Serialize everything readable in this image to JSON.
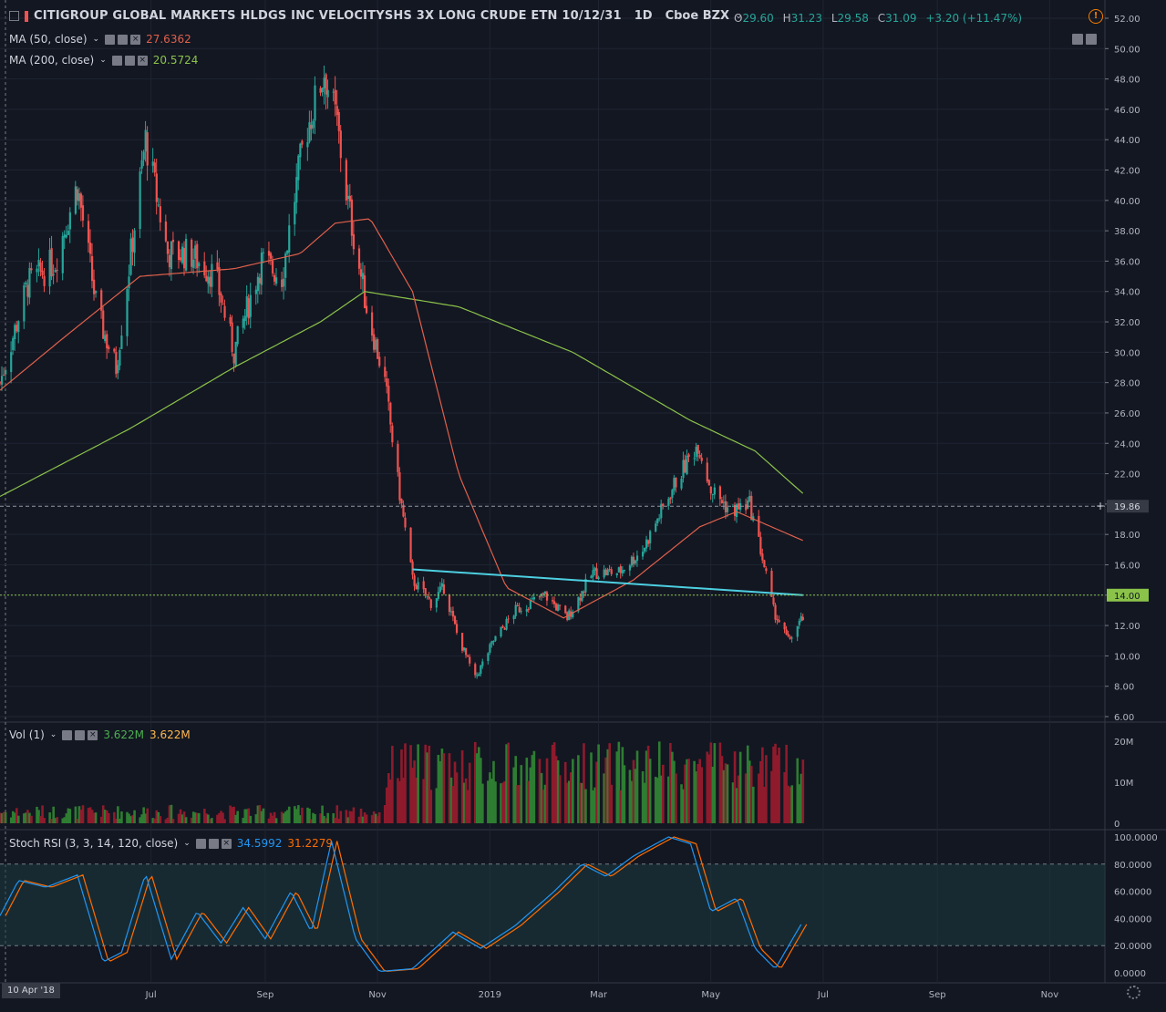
{
  "header": {
    "title": "CITIGROUP GLOBAL MARKETS HLDGS INC VELOCITYSHS 3X LONG CRUDE ETN 10/12/31",
    "interval": "1D",
    "exchange": "Cboe BZX",
    "ohlc": {
      "o": "29.60",
      "h": "31.23",
      "l": "29.58",
      "c": "31.09",
      "change": "+3.20 (+11.47%)"
    }
  },
  "indicators": {
    "ma50": {
      "label": "MA (50, close)",
      "value": "27.6362",
      "color": "#e0604b"
    },
    "ma200": {
      "label": "MA (200, close)",
      "value": "20.5724",
      "color": "#8bc34a"
    },
    "vol": {
      "label": "Vol (1)",
      "value1": "3.622M",
      "value2": "3.622M"
    },
    "stoch": {
      "label": "Stoch RSI (3, 3, 14, 120, close)",
      "k": "34.5992",
      "d": "31.2279",
      "k_color": "#2196f3",
      "d_color": "#ff6d00"
    }
  },
  "date_badge": "10 Apr '18",
  "crosshair_price": "19.86",
  "level_price": "14.00",
  "colors": {
    "up": "#26a69a",
    "down": "#ef5350",
    "bull": "#4caf50",
    "bear": "#e53950",
    "trend": "#4dd0e1",
    "level": "#8bc34a",
    "bg": "#131722",
    "grid": "#1f2432"
  },
  "chart_data": {
    "type": "line",
    "price_axis": {
      "ylim": [
        6,
        52
      ],
      "ticks": [
        "52.00",
        "50.00",
        "48.00",
        "46.00",
        "44.00",
        "42.00",
        "40.00",
        "38.00",
        "36.00",
        "34.00",
        "32.00",
        "30.00",
        "28.00",
        "26.00",
        "24.00",
        "22.00",
        "20.00",
        "18.00",
        "16.00",
        "14.00",
        "12.00",
        "10.00",
        "8.00",
        "6.00"
      ]
    },
    "x_ticks": [
      {
        "label": "Jul",
        "date": "2018-07-01"
      },
      {
        "label": "Sep",
        "date": "2018-09-01"
      },
      {
        "label": "Nov",
        "date": "2018-11-01"
      },
      {
        "label": "2019",
        "date": "2019-01-01"
      },
      {
        "label": "Mar",
        "date": "2019-03-01"
      },
      {
        "label": "May",
        "date": "2019-05-01"
      },
      {
        "label": "Jul",
        "date": "2019-07-01"
      },
      {
        "label": "Sep",
        "date": "2019-09-01"
      },
      {
        "label": "Nov",
        "date": "2019-11-01"
      }
    ],
    "xlim": [
      "2018-04-10",
      "2019-12-01"
    ],
    "price_anchors": [
      [
        "2018-04-10",
        28.0
      ],
      [
        "2018-04-25",
        34.5
      ],
      [
        "2018-05-10",
        36.0
      ],
      [
        "2018-05-22",
        41.0
      ],
      [
        "2018-06-02",
        32.5
      ],
      [
        "2018-06-12",
        29.0
      ],
      [
        "2018-06-28",
        44.0
      ],
      [
        "2018-07-10",
        36.5
      ],
      [
        "2018-07-22",
        36.5
      ],
      [
        "2018-08-05",
        35.0
      ],
      [
        "2018-08-15",
        30.0
      ],
      [
        "2018-08-30",
        36.0
      ],
      [
        "2018-09-10",
        35.0
      ],
      [
        "2018-09-22",
        44.0
      ],
      [
        "2018-10-03",
        48.5
      ],
      [
        "2018-10-10",
        45.0
      ],
      [
        "2018-10-15",
        40.5
      ],
      [
        "2018-10-20",
        37.0
      ],
      [
        "2018-10-26",
        33.0
      ],
      [
        "2018-11-05",
        28.0
      ],
      [
        "2018-11-12",
        21.5
      ],
      [
        "2018-11-20",
        15.0
      ],
      [
        "2018-11-30",
        13.5
      ],
      [
        "2018-12-07",
        14.5
      ],
      [
        "2018-12-14",
        11.5
      ],
      [
        "2018-12-24",
        8.5
      ],
      [
        "2019-01-03",
        11.0
      ],
      [
        "2019-01-15",
        13.0
      ],
      [
        "2019-01-31",
        14.0
      ],
      [
        "2019-02-12",
        12.5
      ],
      [
        "2019-02-26",
        15.5
      ],
      [
        "2019-03-12",
        15.5
      ],
      [
        "2019-03-25",
        17.0
      ],
      [
        "2019-04-06",
        20.0
      ],
      [
        "2019-04-12",
        21.5
      ],
      [
        "2019-04-24",
        24.0
      ],
      [
        "2019-05-01",
        21.0
      ],
      [
        "2019-05-12",
        19.5
      ],
      [
        "2019-05-22",
        20.0
      ],
      [
        "2019-05-28",
        17.0
      ],
      [
        "2019-06-04",
        13.0
      ],
      [
        "2019-06-12",
        11.0
      ],
      [
        "2019-06-20",
        12.5
      ]
    ],
    "ma50_anchors": [
      [
        "2018-04-10",
        27.5
      ],
      [
        "2018-05-15",
        31.0
      ],
      [
        "2018-06-25",
        35.0
      ],
      [
        "2018-08-15",
        35.5
      ],
      [
        "2018-09-20",
        36.5
      ],
      [
        "2018-10-09",
        38.5
      ],
      [
        "2018-10-28",
        38.8
      ],
      [
        "2018-11-20",
        34.0
      ],
      [
        "2018-12-15",
        22.0
      ],
      [
        "2019-01-10",
        14.5
      ],
      [
        "2019-02-10",
        12.5
      ],
      [
        "2019-03-20",
        15.0
      ],
      [
        "2019-04-25",
        18.5
      ],
      [
        "2019-05-15",
        19.5
      ],
      [
        "2019-06-20",
        17.6
      ]
    ],
    "ma200_anchors": [
      [
        "2018-04-10",
        20.5
      ],
      [
        "2018-06-20",
        25.0
      ],
      [
        "2018-08-15",
        29.0
      ],
      [
        "2018-10-01",
        32.0
      ],
      [
        "2018-10-25",
        34.0
      ],
      [
        "2018-12-15",
        33.0
      ],
      [
        "2019-02-15",
        30.0
      ],
      [
        "2019-04-20",
        25.5
      ],
      [
        "2019-05-25",
        23.5
      ],
      [
        "2019-06-20",
        20.7
      ]
    ],
    "trendline": [
      [
        "2018-11-20",
        15.7
      ],
      [
        "2019-06-20",
        14.0
      ]
    ],
    "level": 14.0,
    "crosshair": 19.86,
    "volume": {
      "ylim": [
        0,
        23
      ],
      "ticks": [
        "20M",
        "10M",
        "0"
      ],
      "last": 3.622
    },
    "stoch_rsi": {
      "ylim": [
        0,
        100
      ],
      "ticks": [
        "100.0000",
        "80.0000",
        "60.0000",
        "40.0000",
        "20.0000",
        "0.0000"
      ],
      "band": [
        20,
        80
      ],
      "k_anchors": [
        [
          "2018-04-10",
          42
        ],
        [
          "2018-04-20",
          68
        ],
        [
          "2018-05-05",
          63
        ],
        [
          "2018-05-22",
          72
        ],
        [
          "2018-06-05",
          8
        ],
        [
          "2018-06-15",
          15
        ],
        [
          "2018-06-28",
          73
        ],
        [
          "2018-07-12",
          10
        ],
        [
          "2018-07-26",
          45
        ],
        [
          "2018-08-08",
          22
        ],
        [
          "2018-08-20",
          48
        ],
        [
          "2018-09-01",
          25
        ],
        [
          "2018-09-15",
          60
        ],
        [
          "2018-09-26",
          30
        ],
        [
          "2018-10-07",
          97
        ],
        [
          "2018-10-20",
          25
        ],
        [
          "2018-11-02",
          1
        ],
        [
          "2018-11-20",
          3
        ],
        [
          "2018-12-12",
          30
        ],
        [
          "2018-12-27",
          18
        ],
        [
          "2019-01-15",
          35
        ],
        [
          "2019-02-05",
          60
        ],
        [
          "2019-02-20",
          80
        ],
        [
          "2019-03-05",
          71
        ],
        [
          "2019-03-20",
          86
        ],
        [
          "2019-04-08",
          100
        ],
        [
          "2019-04-20",
          95
        ],
        [
          "2019-05-01",
          45
        ],
        [
          "2019-05-15",
          55
        ],
        [
          "2019-05-25",
          18
        ],
        [
          "2019-06-05",
          3
        ],
        [
          "2019-06-20",
          38
        ]
      ]
    }
  }
}
